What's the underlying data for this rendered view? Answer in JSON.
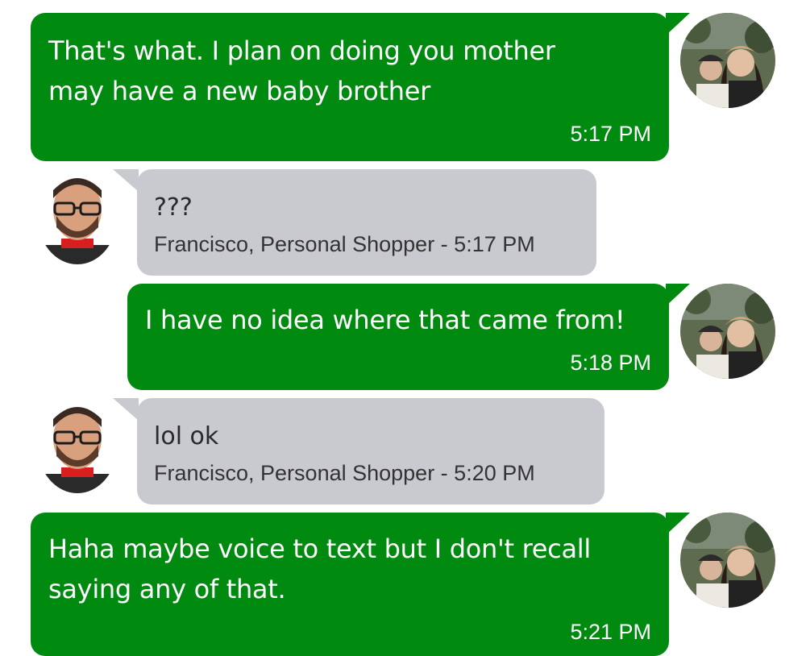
{
  "messages": [
    {
      "id": "m1",
      "direction": "sent",
      "text_lines": [
        "That's what. I plan on doing you mother",
        "may have a new baby brother"
      ],
      "time": "5:17 PM"
    },
    {
      "id": "m2",
      "direction": "received",
      "text": "???",
      "meta": "Francisco, Personal Shopper - 5:17 PM"
    },
    {
      "id": "m3",
      "direction": "sent",
      "text_lines": [
        "I have no idea where that came from!"
      ],
      "time": "5:18 PM"
    },
    {
      "id": "m4",
      "direction": "received",
      "text": "lol ok",
      "meta": "Francisco, Personal Shopper - 5:20 PM"
    },
    {
      "id": "m5",
      "direction": "sent",
      "text_lines": [
        "Haha maybe voice to text but I don't recall",
        "saying any of that."
      ],
      "time": "5:21 PM"
    }
  ],
  "colors": {
    "sent_bubble": "#008a10",
    "received_bubble": "#c9c9d0",
    "background": "#ffffff"
  },
  "icons": {
    "user_avatar": "user-avatar-photo",
    "shopper_avatar": "shopper-avatar-photo"
  }
}
